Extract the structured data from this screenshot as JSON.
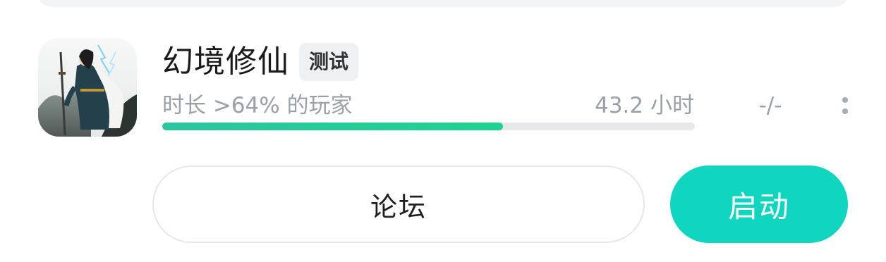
{
  "game": {
    "icon_name": "game-cover-icon",
    "title": "幻境修仙",
    "tag": "测试",
    "stat_label": "时长 >64% 的玩家",
    "hours": "43.2 小时",
    "achievement": "-/-",
    "progress_percent": 64
  },
  "actions": {
    "forum_label": "论坛",
    "launch_label": "启动"
  },
  "colors": {
    "accent": "#10d6bf",
    "progress": "#1fd28f",
    "track": "#e6e8eb",
    "muted_text": "#9aa0a6"
  }
}
